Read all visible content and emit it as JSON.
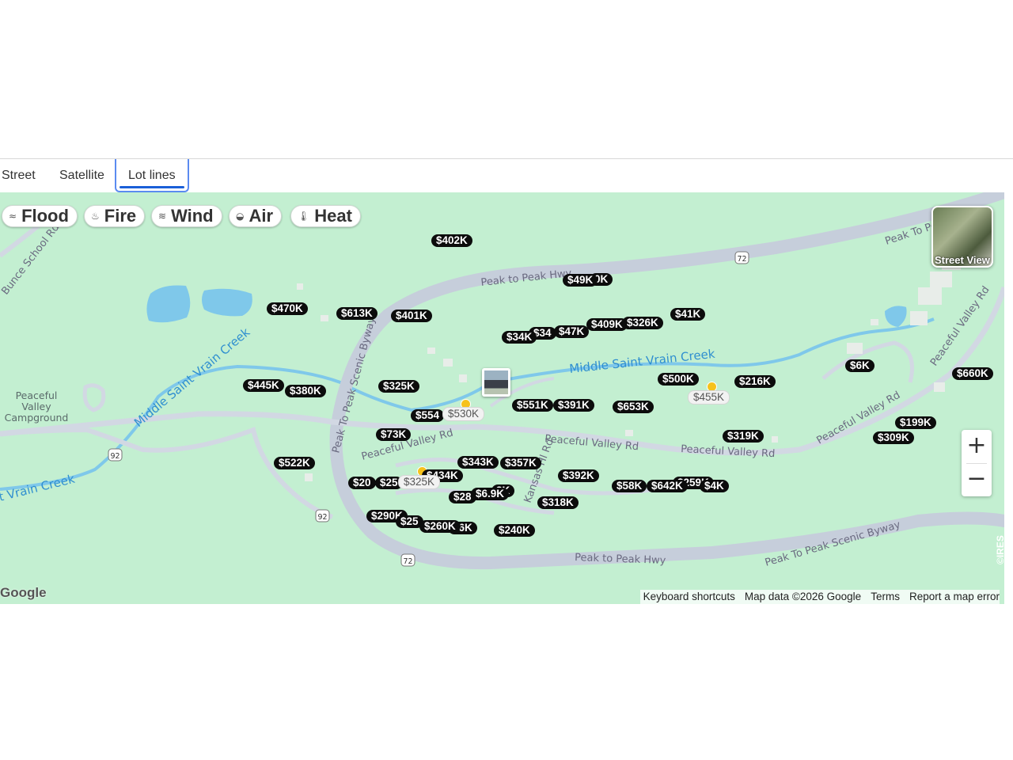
{
  "tabs": [
    "Street",
    "Satellite",
    "Lot lines"
  ],
  "active_tab": "Lot lines",
  "hazard_chips": [
    {
      "label": "Flood",
      "icon": "waves-icon"
    },
    {
      "label": "Fire",
      "icon": "flame-icon"
    },
    {
      "label": "Wind",
      "icon": "wind-icon"
    },
    {
      "label": "Air",
      "icon": "mask-icon"
    },
    {
      "label": "Heat",
      "icon": "thermometer-icon"
    }
  ],
  "street_view_label": "Street View",
  "zoom": {
    "in": "+",
    "out": "−"
  },
  "map_labels": {
    "bunce": "Bunce School Rd",
    "peak_hwy_top": "Peak to Peak Hwy",
    "peak_byway_left": "Peak To Peak Scenic Byway",
    "peak_top_right": "Peak To Pe",
    "creek_left": "Middle Saint Vrain Creek",
    "creek_right": "Middle Saint Vrain Creek",
    "creek_bottom": "t Vrain Creek",
    "peaceful_valley_1": "Peaceful Valley Rd",
    "peaceful_valley_2": "Peaceful Valley Rd",
    "peaceful_valley_3": "Peaceful Valley Rd",
    "peaceful_valley_4": "Peaceful Valley Rd",
    "peaceful_valley_5": "Peaceful Valley Rd",
    "kansas": "Kansas Hl Rd",
    "peak_hwy_bottom": "Peak to Peak Hwy",
    "peak_byway_bottom": "Peak To Peak Scenic Byway",
    "campground": [
      "Peaceful",
      "Valley",
      "Campground"
    ],
    "route_72a": "72",
    "route_72b": "72",
    "route_92a": "92",
    "route_92b": "92"
  },
  "prices": [
    {
      "label": "$402K",
      "style": "dark"
    },
    {
      "label": "$49K",
      "style": "dark"
    },
    {
      "label": "0K",
      "style": "dark"
    },
    {
      "label": "$470K",
      "style": "dark"
    },
    {
      "label": "$613K",
      "style": "dark"
    },
    {
      "label": "$401K",
      "style": "dark"
    },
    {
      "label": "$41K",
      "style": "dark"
    },
    {
      "label": "$409K",
      "style": "dark"
    },
    {
      "label": "$326K",
      "style": "dark"
    },
    {
      "label": "$47K",
      "style": "dark"
    },
    {
      "label": "$34K",
      "style": "dark"
    },
    {
      "label": "$34",
      "style": "dark"
    },
    {
      "label": "$6K",
      "style": "dark"
    },
    {
      "label": "$660K",
      "style": "dark"
    },
    {
      "label": "$445K",
      "style": "dark"
    },
    {
      "label": "$380K",
      "style": "dark"
    },
    {
      "label": "$325K",
      "style": "dark"
    },
    {
      "label": "$500K",
      "style": "dark"
    },
    {
      "label": "$216K",
      "style": "dark"
    },
    {
      "label": "$455K",
      "style": "light"
    },
    {
      "label": "$551K",
      "style": "dark"
    },
    {
      "label": "$391K",
      "style": "dark"
    },
    {
      "label": "$653K",
      "style": "dark"
    },
    {
      "label": "$554",
      "style": "dark"
    },
    {
      "label": "$530K",
      "style": "light"
    },
    {
      "label": "$73K",
      "style": "dark"
    },
    {
      "label": "$199K",
      "style": "dark"
    },
    {
      "label": "$309K",
      "style": "dark"
    },
    {
      "label": "$319K",
      "style": "dark"
    },
    {
      "label": "$522K",
      "style": "dark"
    },
    {
      "label": "$343K",
      "style": "dark"
    },
    {
      "label": "$357K",
      "style": "dark"
    },
    {
      "label": "$434K",
      "style": "dark"
    },
    {
      "label": "$392K",
      "style": "dark"
    },
    {
      "label": "$20",
      "style": "dark"
    },
    {
      "label": "$25",
      "style": "dark"
    },
    {
      "label": "$325K",
      "style": "light"
    },
    {
      "label": "$58K",
      "style": "dark"
    },
    {
      "label": "$642K",
      "style": "dark"
    },
    {
      "label": "$259K",
      "style": "dark"
    },
    {
      "label": "$4K",
      "style": "dark"
    },
    {
      "label": "$28",
      "style": "dark"
    },
    {
      "label": "$6.9K",
      "style": "dark"
    },
    {
      "label": "3K",
      "style": "dark"
    },
    {
      "label": "$318K",
      "style": "dark"
    },
    {
      "label": "$290K",
      "style": "dark"
    },
    {
      "label": "$25",
      "style": "dark"
    },
    {
      "label": "$260K",
      "style": "dark"
    },
    {
      "label": "46K",
      "style": "dark"
    },
    {
      "label": "$240K",
      "style": "dark"
    }
  ],
  "attribution": {
    "google": "Google",
    "shortcuts": "Keyboard shortcuts",
    "map_data": "Map data ©2026 Google",
    "terms": "Terms",
    "report": "Report a map error",
    "ires": "©IRES"
  }
}
